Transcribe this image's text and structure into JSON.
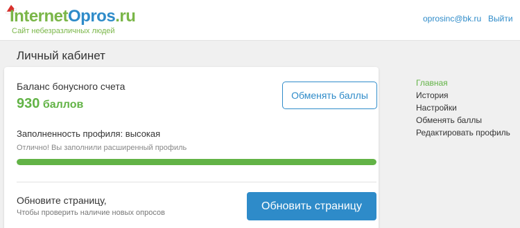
{
  "header": {
    "logo": {
      "part1": "Internet",
      "part2": "Opros",
      "part3": ".ru",
      "tagline": "Сайт небезразличных людей"
    },
    "email": "oprosinc@bk.ru",
    "logout_label": "Выйти"
  },
  "page": {
    "title": "Личный кабинет"
  },
  "balance": {
    "label": "Баланс бонусного счета",
    "value": "930",
    "unit": "баллов",
    "exchange_button": "Обменять баллы"
  },
  "profile": {
    "label": "Заполненность профиля: высокая",
    "subtitle": "Отлично! Вы заполнили расширенный профиль",
    "progress_percent": 100
  },
  "refresh": {
    "label": "Обновите страницу,",
    "subtitle": "Чтобы проверить наличие новых опросов",
    "button": "Обновить страницу"
  },
  "sidebar": {
    "items": [
      {
        "label": "Главная",
        "active": true
      },
      {
        "label": "История",
        "active": false
      },
      {
        "label": "Настройки",
        "active": false
      },
      {
        "label": "Обменять баллы",
        "active": false
      },
      {
        "label": "Редактировать профиль",
        "active": false
      }
    ]
  },
  "colors": {
    "green": "#62b346",
    "blue": "#2e8bc9",
    "logo_green": "#7ab648"
  }
}
